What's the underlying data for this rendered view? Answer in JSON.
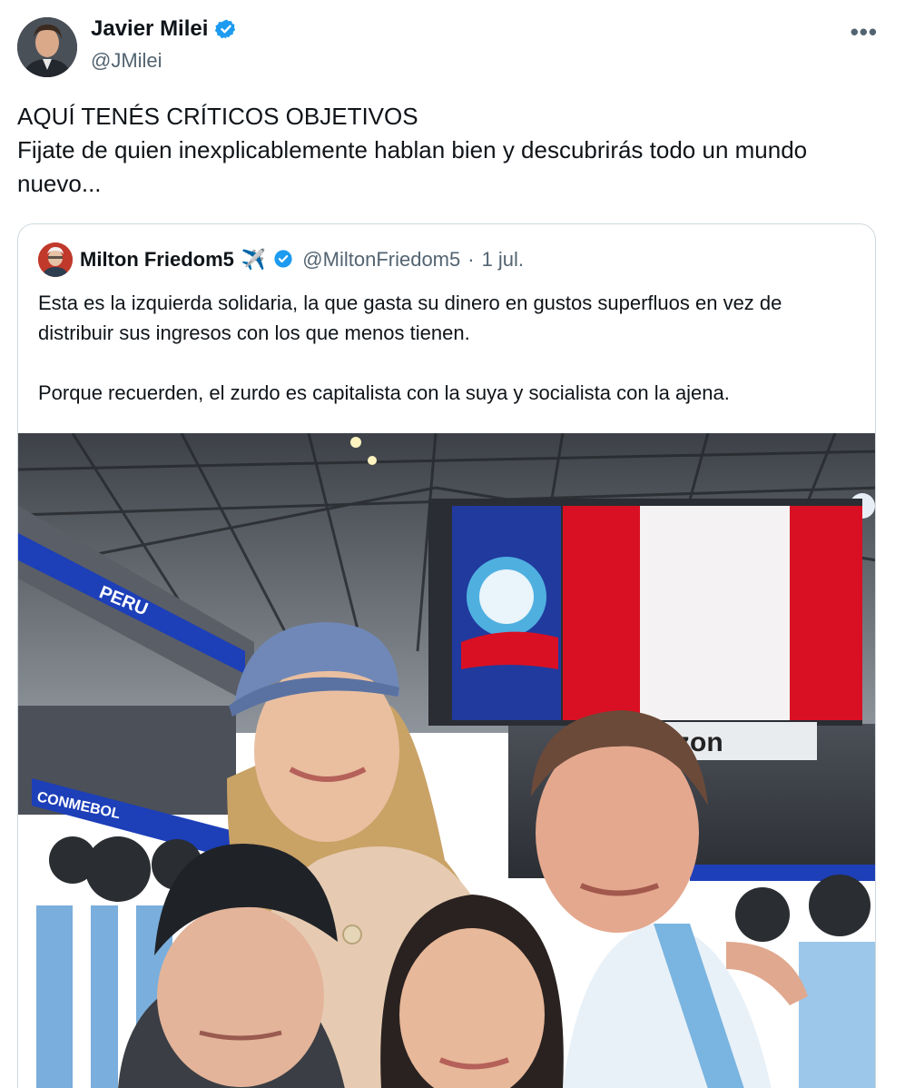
{
  "author": {
    "name": "Javier Milei",
    "handle": "@JMilei",
    "verified": true
  },
  "more_icon": "more-horizontal-icon",
  "tweet": {
    "line1": "AQUÍ TENÉS CRÍTICOS OBJETIVOS",
    "line2": "Fijate de quien inexplicablemente hablan bien y descubrirás todo un mundo nuevo..."
  },
  "quoted_tweet": {
    "name": "Milton Friedom5",
    "emoji": "✈️",
    "handle": "@MiltonFriedom5",
    "separator": "·",
    "date": "1 jul.",
    "paragraph1": "Esta es la izquierda solidaria, la que gasta su dinero en gustos superfluos en vez de distribuir sus ingresos con los que menos tienen.",
    "paragraph2": "Porque recuerden, el zurdo es capitalista con la suya y socialista con la ajena."
  },
  "photo": {
    "banner_text": "PERU",
    "sponsor_text": "rizon",
    "board_text": "CONMEBOL"
  },
  "colors": {
    "verified_blue": "#1d9bf0",
    "text": "#0f1419",
    "secondary_text": "#536471",
    "border": "#cfd9de",
    "peru_red": "#d91023"
  }
}
